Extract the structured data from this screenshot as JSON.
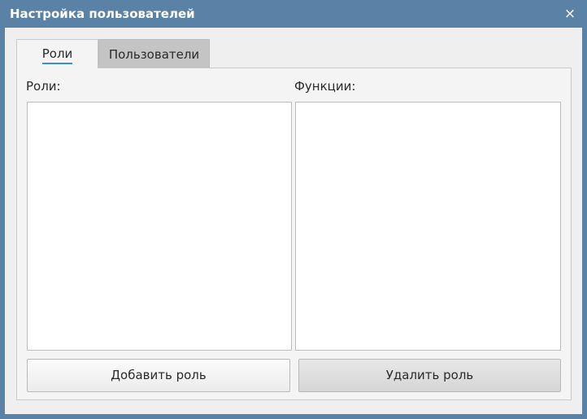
{
  "window": {
    "title": "Настройка пользователей",
    "close_symbol": "×",
    "accent_color": "#5a81a6"
  },
  "tabs": [
    {
      "label": "Роли",
      "selected": true
    },
    {
      "label": "Пользователи",
      "selected": false
    }
  ],
  "roles_tab": {
    "roles_label": "Роли:",
    "functions_label": "Функции:",
    "roles_items": [],
    "functions_items": [],
    "add_button": "Добавить роль",
    "delete_button": "Удалить роль"
  }
}
